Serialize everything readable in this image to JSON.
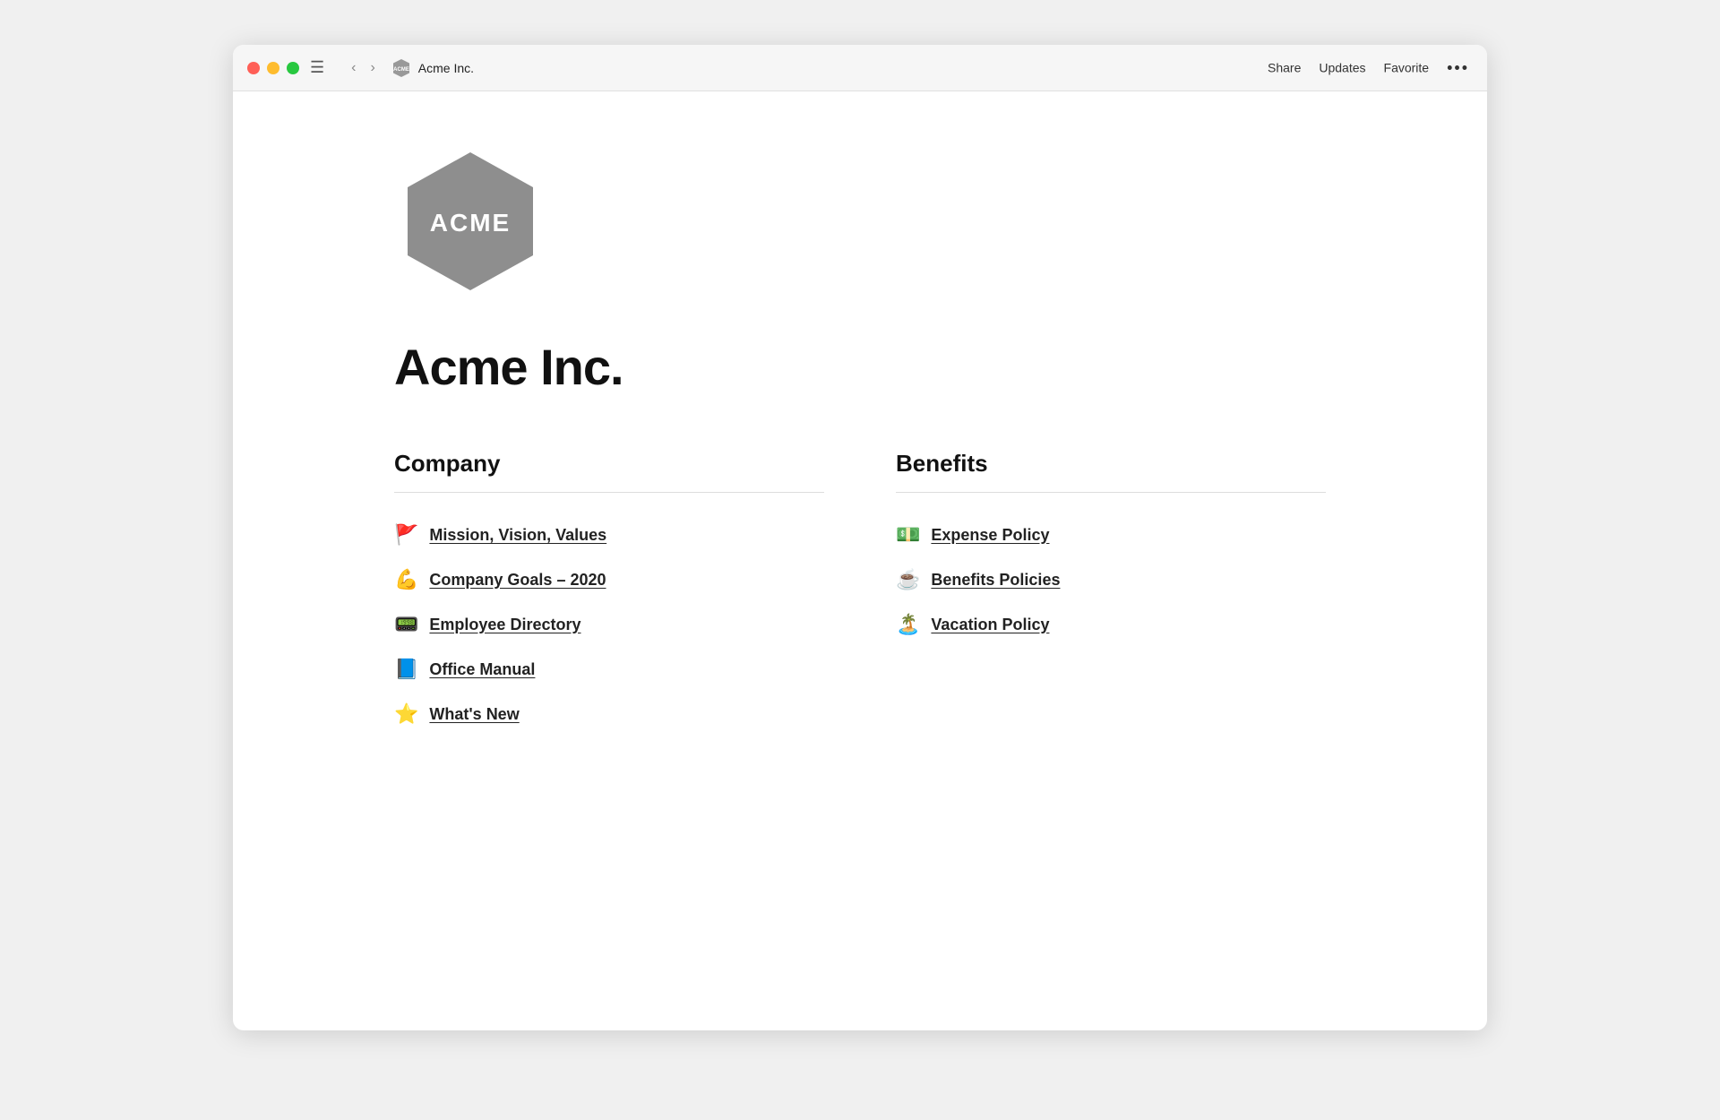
{
  "window": {
    "title": "Acme Inc.",
    "titlebar": {
      "traffic": {
        "close_label": "close",
        "minimize_label": "minimize",
        "maximize_label": "maximize"
      },
      "nav": {
        "back_label": "‹",
        "forward_label": "›",
        "sidebar_label": "☰"
      },
      "breadcrumb": {
        "page_title": "Acme Inc."
      },
      "actions": {
        "share": "Share",
        "updates": "Updates",
        "favorite": "Favorite",
        "more": "•••"
      }
    }
  },
  "content": {
    "page_heading": "Acme Inc.",
    "sections": [
      {
        "id": "company",
        "heading": "Company",
        "links": [
          {
            "emoji": "🚩",
            "text": "Mission, Vision, Values"
          },
          {
            "emoji": "💪",
            "text": "Company Goals – 2020"
          },
          {
            "emoji": "📟",
            "text": "Employee Directory"
          },
          {
            "emoji": "📘",
            "text": "Office Manual"
          },
          {
            "emoji": "⭐",
            "text": "What's New"
          }
        ]
      },
      {
        "id": "benefits",
        "heading": "Benefits",
        "links": [
          {
            "emoji": "💵",
            "text": "Expense Policy"
          },
          {
            "emoji": "☕",
            "text": "Benefits Policies"
          },
          {
            "emoji": "🏝️",
            "text": "Vacation Policy"
          }
        ]
      }
    ]
  }
}
